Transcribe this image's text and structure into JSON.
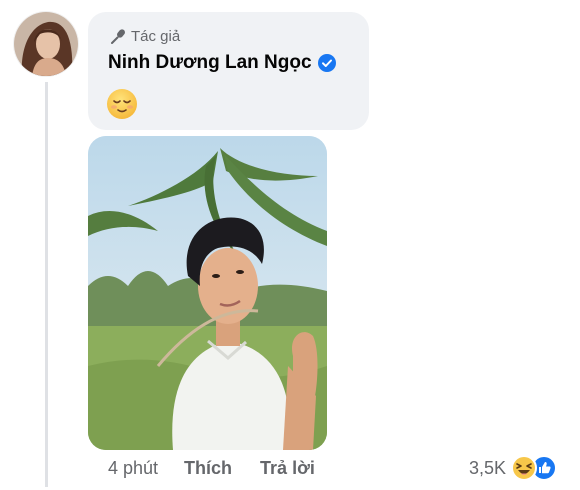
{
  "comment": {
    "author_tag": "Tác giả",
    "author_name": "Ninh Dương Lan Ngọc",
    "verified": true,
    "emoji": "relieved-face",
    "has_photo": true
  },
  "actions": {
    "time": "4 phút",
    "like_label": "Thích",
    "reply_label": "Trả lời"
  },
  "reactions": {
    "count": "3,5K",
    "icons": [
      "haha-icon",
      "like-icon"
    ]
  },
  "colors": {
    "verified_blue": "#1877f2",
    "bubble_bg": "#f0f2f5",
    "secondary_text": "#65676b",
    "primary_text": "#050505"
  }
}
